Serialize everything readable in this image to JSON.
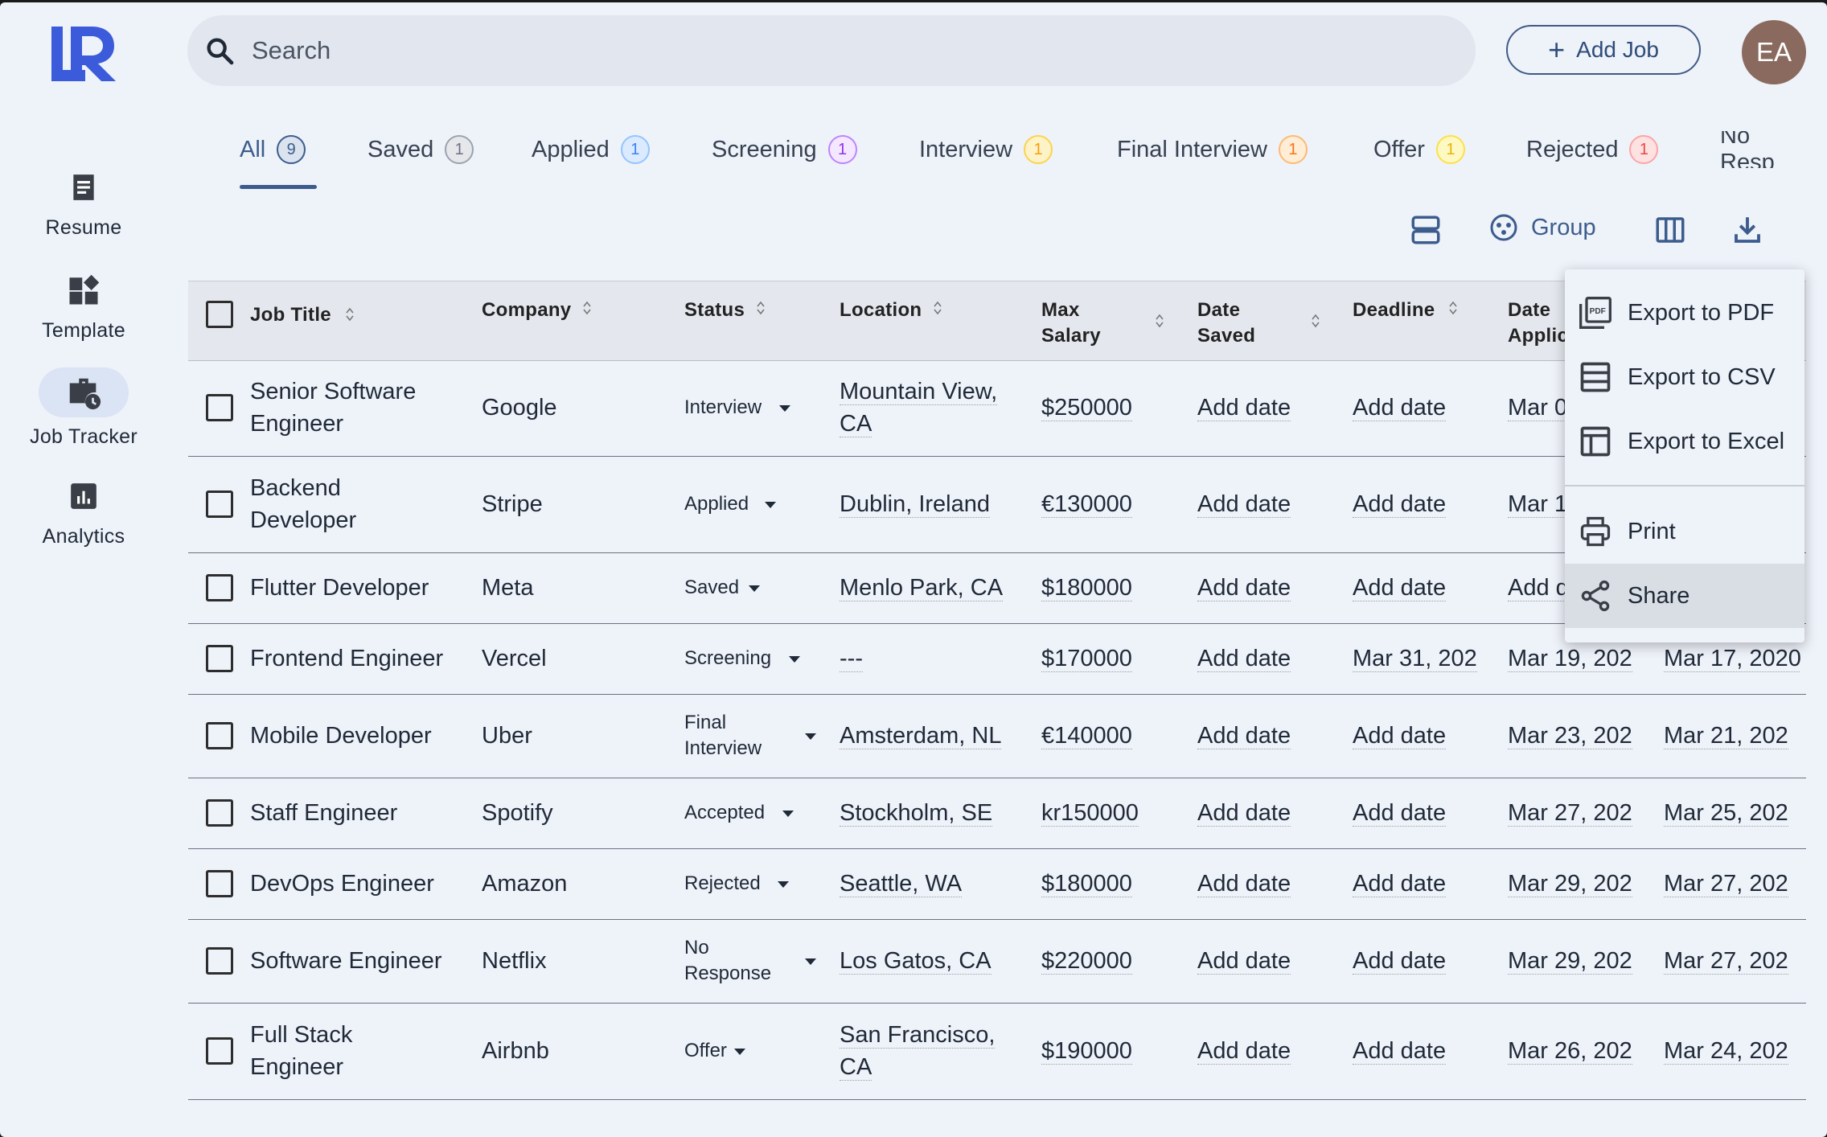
{
  "sidebar": {
    "logo_text": "LR",
    "items": [
      {
        "label": "Resume",
        "icon": "document-icon"
      },
      {
        "label": "Template",
        "icon": "widgets-icon"
      },
      {
        "label": "Job Tracker",
        "icon": "briefcase-clock-icon"
      },
      {
        "label": "Analytics",
        "icon": "bar-chart-icon"
      }
    ]
  },
  "header": {
    "search_placeholder": "Search",
    "add_job_label": "Add Job",
    "avatar_initials": "EA"
  },
  "tabs": [
    {
      "label": "All",
      "count": "9",
      "color": "#3c5c8d"
    },
    {
      "label": "Saved",
      "count": "1",
      "color": "#6b7280"
    },
    {
      "label": "Applied",
      "count": "1",
      "color": "#3b82f6"
    },
    {
      "label": "Screening",
      "count": "1",
      "color": "#9333ea"
    },
    {
      "label": "Interview",
      "count": "1",
      "color": "#f59e0b"
    },
    {
      "label": "Final Interview",
      "count": "1",
      "color": "#f97316"
    },
    {
      "label": "Offer",
      "count": "1",
      "color": "#eab308"
    },
    {
      "label": "Rejected",
      "count": "1",
      "color": "#ef4444"
    },
    {
      "label": "No Resp",
      "count": "",
      "color": ""
    }
  ],
  "toolbar": {
    "group_label": "Group"
  },
  "table": {
    "columns": {
      "job_title": "Job Title",
      "company": "Company",
      "status": "Status",
      "location": "Location",
      "max_salary_1": "Max",
      "max_salary_2": "Salary",
      "date_saved_1": "Date",
      "date_saved_2": "Saved",
      "deadline": "Deadline",
      "date_applied_1": "Date",
      "date_applied_2": "Applic"
    },
    "rows": [
      {
        "title1": "Senior Software",
        "title2": "Engineer",
        "company": "Google",
        "status1": "Interview",
        "status2": "",
        "loc1": "Mountain View,",
        "loc2": "CA",
        "salary": "$250000",
        "saved": "Add date",
        "deadline": "Add date",
        "applied": "Mar 0",
        "extra": ""
      },
      {
        "title1": "Backend",
        "title2": "Developer",
        "company": "Stripe",
        "status1": "Applied",
        "status2": "",
        "loc1": "Dublin, Ireland",
        "loc2": "",
        "salary": "€130000",
        "saved": "Add date",
        "deadline": "Add date",
        "applied": "Mar 1",
        "extra": ""
      },
      {
        "title1": "Flutter Developer",
        "title2": "",
        "company": "Meta",
        "status1": "Saved",
        "status2": "",
        "loc1": "Menlo Park, CA",
        "loc2": "",
        "salary": "$180000",
        "saved": "Add date",
        "deadline": "Add date",
        "applied": "Add d",
        "extra": ""
      },
      {
        "title1": "Frontend Engineer",
        "title2": "",
        "company": "Vercel",
        "status1": "Screening",
        "status2": "",
        "loc1": "---",
        "loc2": "",
        "salary": "$170000",
        "saved": "Add date",
        "deadline": "Mar 31, 202",
        "applied": "Mar 19, 202",
        "extra": "Mar 17, 2020"
      },
      {
        "title1": "Mobile Developer",
        "title2": "",
        "company": "Uber",
        "status1": "Final",
        "status2": "Interview",
        "loc1": "Amsterdam, NL",
        "loc2": "",
        "salary": "€140000",
        "saved": "Add date",
        "deadline": "Add date",
        "applied": "Mar 23, 202",
        "extra": "Mar 21, 202"
      },
      {
        "title1": "Staff Engineer",
        "title2": "",
        "company": "Spotify",
        "status1": "Accepted",
        "status2": "",
        "loc1": "Stockholm, SE",
        "loc2": "",
        "salary": "kr150000",
        "saved": "Add date",
        "deadline": "Add date",
        "applied": "Mar 27, 202",
        "extra": "Mar 25, 202"
      },
      {
        "title1": "DevOps Engineer",
        "title2": "",
        "company": "Amazon",
        "status1": "Rejected",
        "status2": "",
        "loc1": "Seattle, WA",
        "loc2": "",
        "salary": "$180000",
        "saved": "Add date",
        "deadline": "Add date",
        "applied": "Mar 29, 202",
        "extra": "Mar 27, 202"
      },
      {
        "title1": "Software Engineer",
        "title2": "",
        "company": "Netflix",
        "status1": "No",
        "status2": "Response",
        "loc1": "Los Gatos, CA",
        "loc2": "",
        "salary": "$220000",
        "saved": "Add date",
        "deadline": "Add date",
        "applied": "Mar 29, 202",
        "extra": "Mar 27, 202"
      },
      {
        "title1": "Full Stack",
        "title2": "Engineer",
        "company": "Airbnb",
        "status1": "Offer",
        "status2": "",
        "loc1": "San Francisco,",
        "loc2": "CA",
        "salary": "$190000",
        "saved": "Add date",
        "deadline": "Add date",
        "applied": "Mar 26, 202",
        "extra": "Mar 24, 202"
      }
    ]
  },
  "export_menu": {
    "items": [
      {
        "label": "Export to PDF",
        "icon": "pdf-icon"
      },
      {
        "label": "Export to CSV",
        "icon": "csv-icon"
      },
      {
        "label": "Export to Excel",
        "icon": "table-icon"
      },
      {
        "label": "Print",
        "icon": "print-icon"
      },
      {
        "label": "Share",
        "icon": "share-icon"
      }
    ]
  }
}
